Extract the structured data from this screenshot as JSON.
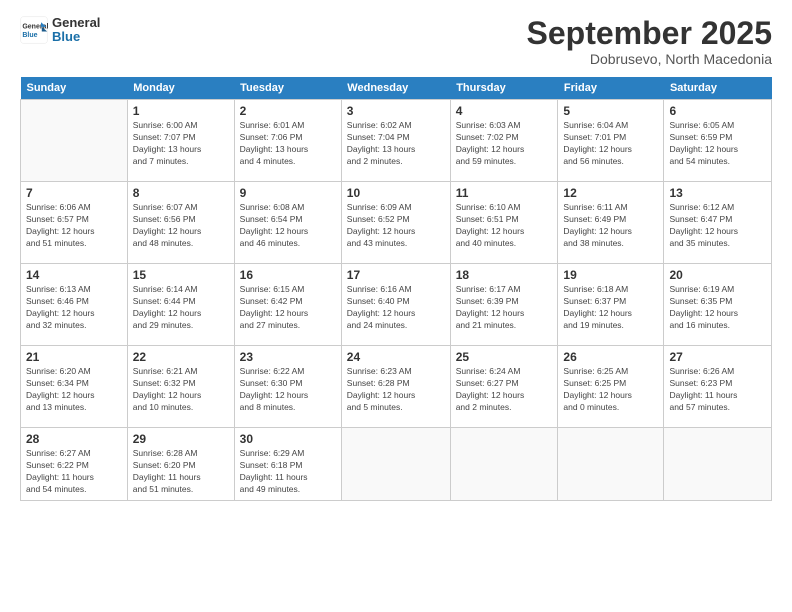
{
  "header": {
    "logo_line1": "General",
    "logo_line2": "Blue",
    "month_title": "September 2025",
    "subtitle": "Dobrusevo, North Macedonia"
  },
  "days_of_week": [
    "Sunday",
    "Monday",
    "Tuesday",
    "Wednesday",
    "Thursday",
    "Friday",
    "Saturday"
  ],
  "weeks": [
    [
      {
        "date": "",
        "info": ""
      },
      {
        "date": "1",
        "info": "Sunrise: 6:00 AM\nSunset: 7:07 PM\nDaylight: 13 hours\nand 7 minutes."
      },
      {
        "date": "2",
        "info": "Sunrise: 6:01 AM\nSunset: 7:06 PM\nDaylight: 13 hours\nand 4 minutes."
      },
      {
        "date": "3",
        "info": "Sunrise: 6:02 AM\nSunset: 7:04 PM\nDaylight: 13 hours\nand 2 minutes."
      },
      {
        "date": "4",
        "info": "Sunrise: 6:03 AM\nSunset: 7:02 PM\nDaylight: 12 hours\nand 59 minutes."
      },
      {
        "date": "5",
        "info": "Sunrise: 6:04 AM\nSunset: 7:01 PM\nDaylight: 12 hours\nand 56 minutes."
      },
      {
        "date": "6",
        "info": "Sunrise: 6:05 AM\nSunset: 6:59 PM\nDaylight: 12 hours\nand 54 minutes."
      }
    ],
    [
      {
        "date": "7",
        "info": "Sunrise: 6:06 AM\nSunset: 6:57 PM\nDaylight: 12 hours\nand 51 minutes."
      },
      {
        "date": "8",
        "info": "Sunrise: 6:07 AM\nSunset: 6:56 PM\nDaylight: 12 hours\nand 48 minutes."
      },
      {
        "date": "9",
        "info": "Sunrise: 6:08 AM\nSunset: 6:54 PM\nDaylight: 12 hours\nand 46 minutes."
      },
      {
        "date": "10",
        "info": "Sunrise: 6:09 AM\nSunset: 6:52 PM\nDaylight: 12 hours\nand 43 minutes."
      },
      {
        "date": "11",
        "info": "Sunrise: 6:10 AM\nSunset: 6:51 PM\nDaylight: 12 hours\nand 40 minutes."
      },
      {
        "date": "12",
        "info": "Sunrise: 6:11 AM\nSunset: 6:49 PM\nDaylight: 12 hours\nand 38 minutes."
      },
      {
        "date": "13",
        "info": "Sunrise: 6:12 AM\nSunset: 6:47 PM\nDaylight: 12 hours\nand 35 minutes."
      }
    ],
    [
      {
        "date": "14",
        "info": "Sunrise: 6:13 AM\nSunset: 6:46 PM\nDaylight: 12 hours\nand 32 minutes."
      },
      {
        "date": "15",
        "info": "Sunrise: 6:14 AM\nSunset: 6:44 PM\nDaylight: 12 hours\nand 29 minutes."
      },
      {
        "date": "16",
        "info": "Sunrise: 6:15 AM\nSunset: 6:42 PM\nDaylight: 12 hours\nand 27 minutes."
      },
      {
        "date": "17",
        "info": "Sunrise: 6:16 AM\nSunset: 6:40 PM\nDaylight: 12 hours\nand 24 minutes."
      },
      {
        "date": "18",
        "info": "Sunrise: 6:17 AM\nSunset: 6:39 PM\nDaylight: 12 hours\nand 21 minutes."
      },
      {
        "date": "19",
        "info": "Sunrise: 6:18 AM\nSunset: 6:37 PM\nDaylight: 12 hours\nand 19 minutes."
      },
      {
        "date": "20",
        "info": "Sunrise: 6:19 AM\nSunset: 6:35 PM\nDaylight: 12 hours\nand 16 minutes."
      }
    ],
    [
      {
        "date": "21",
        "info": "Sunrise: 6:20 AM\nSunset: 6:34 PM\nDaylight: 12 hours\nand 13 minutes."
      },
      {
        "date": "22",
        "info": "Sunrise: 6:21 AM\nSunset: 6:32 PM\nDaylight: 12 hours\nand 10 minutes."
      },
      {
        "date": "23",
        "info": "Sunrise: 6:22 AM\nSunset: 6:30 PM\nDaylight: 12 hours\nand 8 minutes."
      },
      {
        "date": "24",
        "info": "Sunrise: 6:23 AM\nSunset: 6:28 PM\nDaylight: 12 hours\nand 5 minutes."
      },
      {
        "date": "25",
        "info": "Sunrise: 6:24 AM\nSunset: 6:27 PM\nDaylight: 12 hours\nand 2 minutes."
      },
      {
        "date": "26",
        "info": "Sunrise: 6:25 AM\nSunset: 6:25 PM\nDaylight: 12 hours\nand 0 minutes."
      },
      {
        "date": "27",
        "info": "Sunrise: 6:26 AM\nSunset: 6:23 PM\nDaylight: 11 hours\nand 57 minutes."
      }
    ],
    [
      {
        "date": "28",
        "info": "Sunrise: 6:27 AM\nSunset: 6:22 PM\nDaylight: 11 hours\nand 54 minutes."
      },
      {
        "date": "29",
        "info": "Sunrise: 6:28 AM\nSunset: 6:20 PM\nDaylight: 11 hours\nand 51 minutes."
      },
      {
        "date": "30",
        "info": "Sunrise: 6:29 AM\nSunset: 6:18 PM\nDaylight: 11 hours\nand 49 minutes."
      },
      {
        "date": "",
        "info": ""
      },
      {
        "date": "",
        "info": ""
      },
      {
        "date": "",
        "info": ""
      },
      {
        "date": "",
        "info": ""
      }
    ]
  ]
}
